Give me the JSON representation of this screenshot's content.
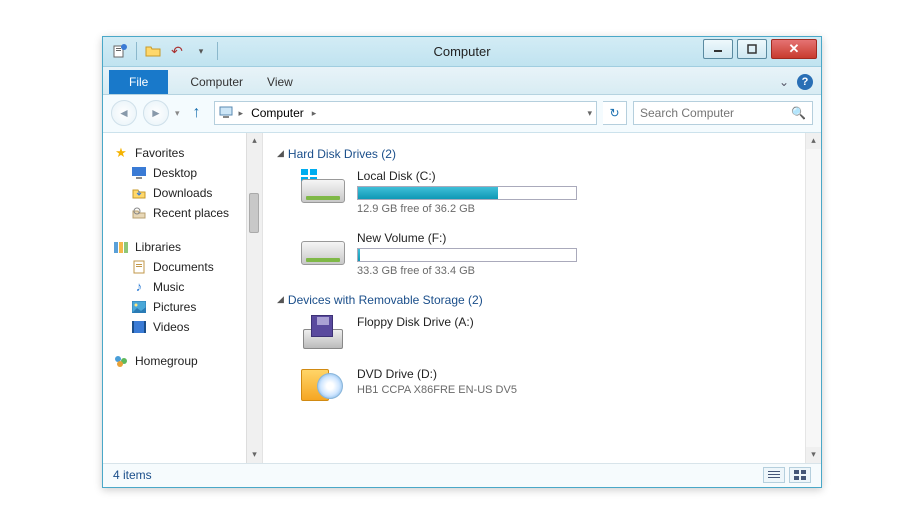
{
  "window": {
    "title": "Computer"
  },
  "ribbon": {
    "file_label": "File",
    "tabs": [
      "Computer",
      "View"
    ]
  },
  "address": {
    "location": "Computer",
    "search_placeholder": "Search Computer"
  },
  "sidebar": {
    "favorites": {
      "label": "Favorites",
      "items": [
        "Desktop",
        "Downloads",
        "Recent places"
      ]
    },
    "libraries": {
      "label": "Libraries",
      "items": [
        "Documents",
        "Music",
        "Pictures",
        "Videos"
      ]
    },
    "homegroup": {
      "label": "Homegroup"
    }
  },
  "groups": [
    {
      "title": "Hard Disk Drives",
      "count": 2,
      "drives": [
        {
          "label": "Local Disk (C:)",
          "free": "12.9 GB free of 36.2 GB",
          "used_pct": 64,
          "system": true
        },
        {
          "label": "New Volume (F:)",
          "free": "33.3 GB free of 33.4 GB",
          "used_pct": 1,
          "system": false
        }
      ]
    },
    {
      "title": "Devices with Removable Storage",
      "count": 2,
      "devices": [
        {
          "label": "Floppy Disk Drive (A:)",
          "sub": "",
          "kind": "floppy"
        },
        {
          "label": "DVD Drive (D:)",
          "sub": "HB1 CCPA X86FRE EN-US DV5",
          "kind": "dvd"
        }
      ]
    }
  ],
  "status": {
    "text": "4 items"
  }
}
